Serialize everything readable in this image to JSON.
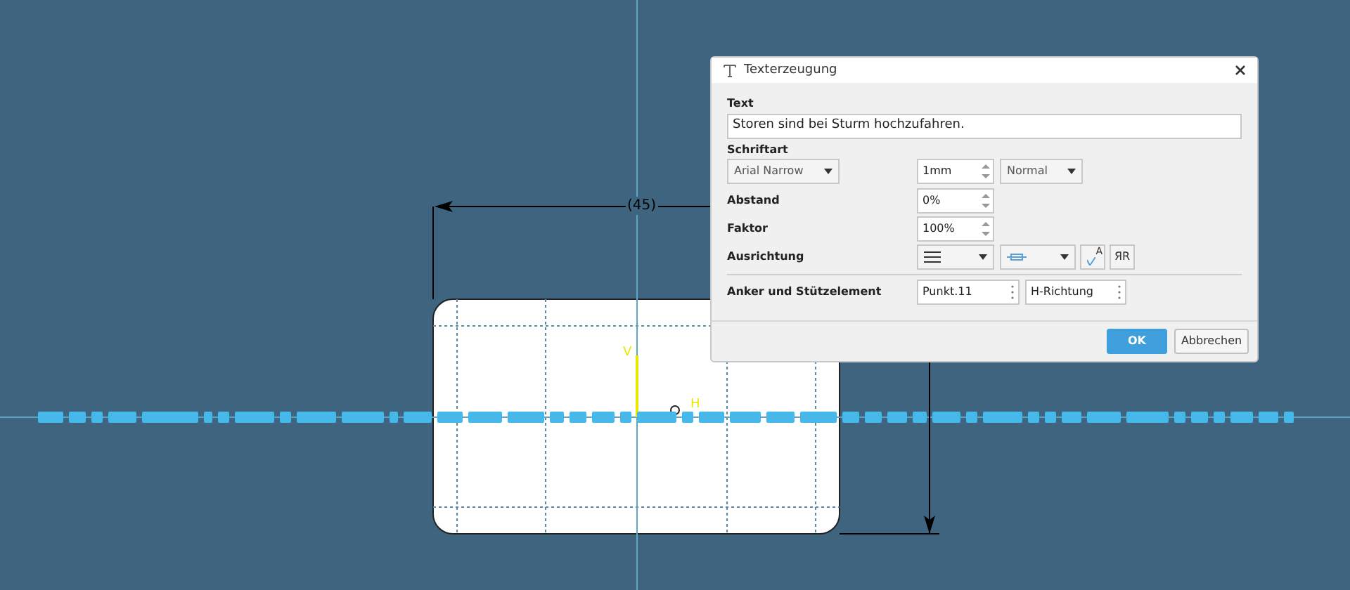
{
  "window": {
    "title": "Texterzeugung"
  },
  "dialog": {
    "text_label": "Text",
    "text_value": "Storen sind bei Sturm hochzufahren.",
    "font_label": "Schriftart",
    "font": "Arial Narrow",
    "size": "1mm",
    "style": "Normal",
    "spacing_label": "Abstand",
    "spacing": "0%",
    "factor_label": "Faktor",
    "factor": "100%",
    "alignment_label": "Ausrichtung",
    "mirror_glyphs": [
      "A",
      "ЯR"
    ],
    "anchor_label": "Anker und Stützelement",
    "anchor": "Punkt.11",
    "direction": "H-Richtung",
    "buttons": [
      {
        "label": "OK",
        "kind": "primary"
      },
      {
        "label": "Abbrechen",
        "kind": "secondary"
      }
    ]
  },
  "canvas": {
    "dimension_label": "(45)",
    "axis_labels": [
      "V",
      "H"
    ]
  }
}
